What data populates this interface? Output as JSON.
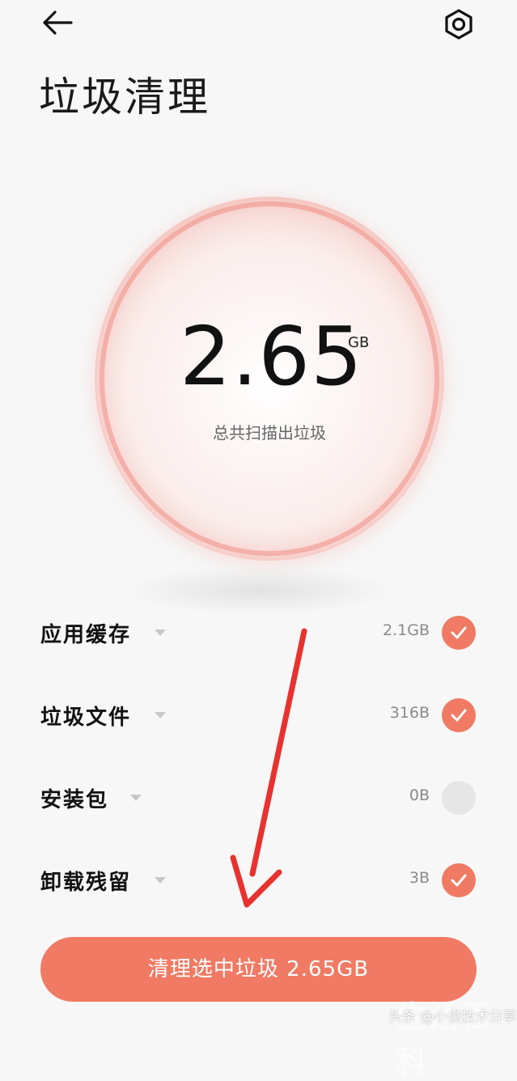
{
  "header": {
    "back_icon": "back-arrow-icon",
    "settings_icon": "gear-icon",
    "title": "垃圾清理"
  },
  "summary": {
    "value": "2.65",
    "unit": "GB",
    "caption": "总共扫描出垃圾"
  },
  "items": [
    {
      "label": "应用缓存",
      "size": "2.1GB",
      "checked": true
    },
    {
      "label": "垃圾文件",
      "size": "316B",
      "checked": true
    },
    {
      "label": "安装包",
      "size": "0B",
      "checked": false
    },
    {
      "label": "卸载残留",
      "size": "3B",
      "checked": true
    }
  ],
  "action": {
    "clean_label": "清理选中垃圾 2.65GB"
  },
  "watermark": {
    "text": "头条 @小俊技术分享",
    "big_text": "生活百科"
  },
  "colors": {
    "accent": "#f07a63",
    "annotation_arrow": "#e8322f"
  }
}
